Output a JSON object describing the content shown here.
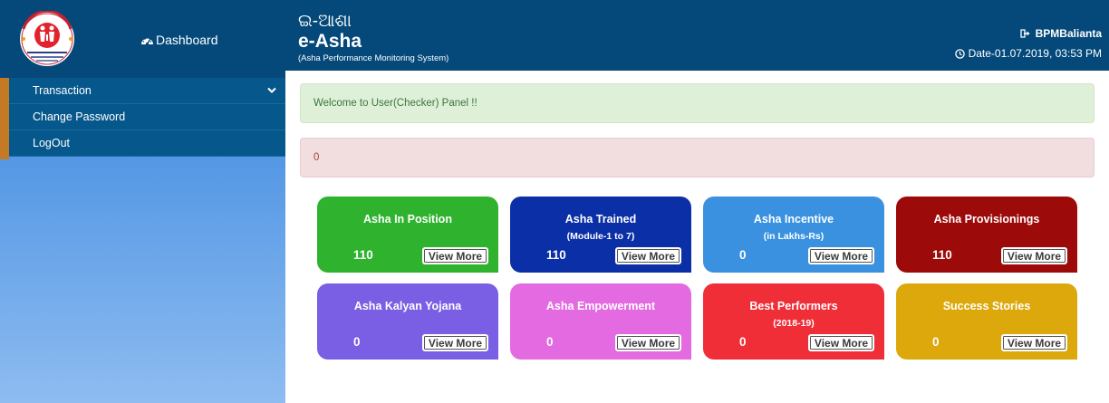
{
  "sidebar": {
    "logo_text": [
      "NATIONAL RURAL HEALTH MISSION",
      "ଜାତୀୟ ଗ୍ରାମୀଣ ସ୍ୱାସ୍ଥ୍ୟ ମିଶନ",
      "ଓଡ଼ିଶା ସରକାର"
    ],
    "dashboard_label": "Dashboard",
    "menu": [
      {
        "label": "Transaction"
      },
      {
        "label": "Change Password"
      },
      {
        "label": "LogOut"
      }
    ]
  },
  "header": {
    "title_odia": "ଇ-ଆଶା",
    "title": "e-Asha",
    "subtitle": "(Asha Performance Monitoring System)",
    "user": "BPMBalianta",
    "date": "Date-01.07.2019, 03:53 PM"
  },
  "alerts": {
    "welcome": "Welcome to User(Checker) Panel !!",
    "error": "0"
  },
  "cards": [
    {
      "title": "Asha In Position",
      "sub": "",
      "count": "110",
      "button": "View More",
      "color": "#2fb32f"
    },
    {
      "title": "Asha Trained",
      "sub": "(Module-1 to 7)",
      "count": "110",
      "button": "View More",
      "color": "#0b2fa6"
    },
    {
      "title": "Asha Incentive",
      "sub": "(in Lakhs-Rs)",
      "count": "0",
      "button": "View More",
      "color": "#3a91e0"
    },
    {
      "title": "Asha Provisionings",
      "sub": "",
      "count": "110",
      "button": "View More",
      "color": "#9c0a0a"
    },
    {
      "title": "Asha Kalyan Yojana",
      "sub": "",
      "count": "0",
      "button": "View More",
      "color": "#7a5ee4"
    },
    {
      "title": "Asha Empowerment",
      "sub": "",
      "count": "0",
      "button": "View More",
      "color": "#e36ae0"
    },
    {
      "title": "Best Performers",
      "sub": "(2018-19)",
      "count": "0",
      "button": "View More",
      "color": "#ef2e37"
    },
    {
      "title": "Success Stories",
      "sub": "",
      "count": "0",
      "button": "View More",
      "color": "#dca80c"
    }
  ],
  "icons": {
    "dashboard": "tachometer-icon",
    "menu_chevron": "chevron-down-icon",
    "user": "sign-out-icon",
    "date": "clock-icon"
  }
}
